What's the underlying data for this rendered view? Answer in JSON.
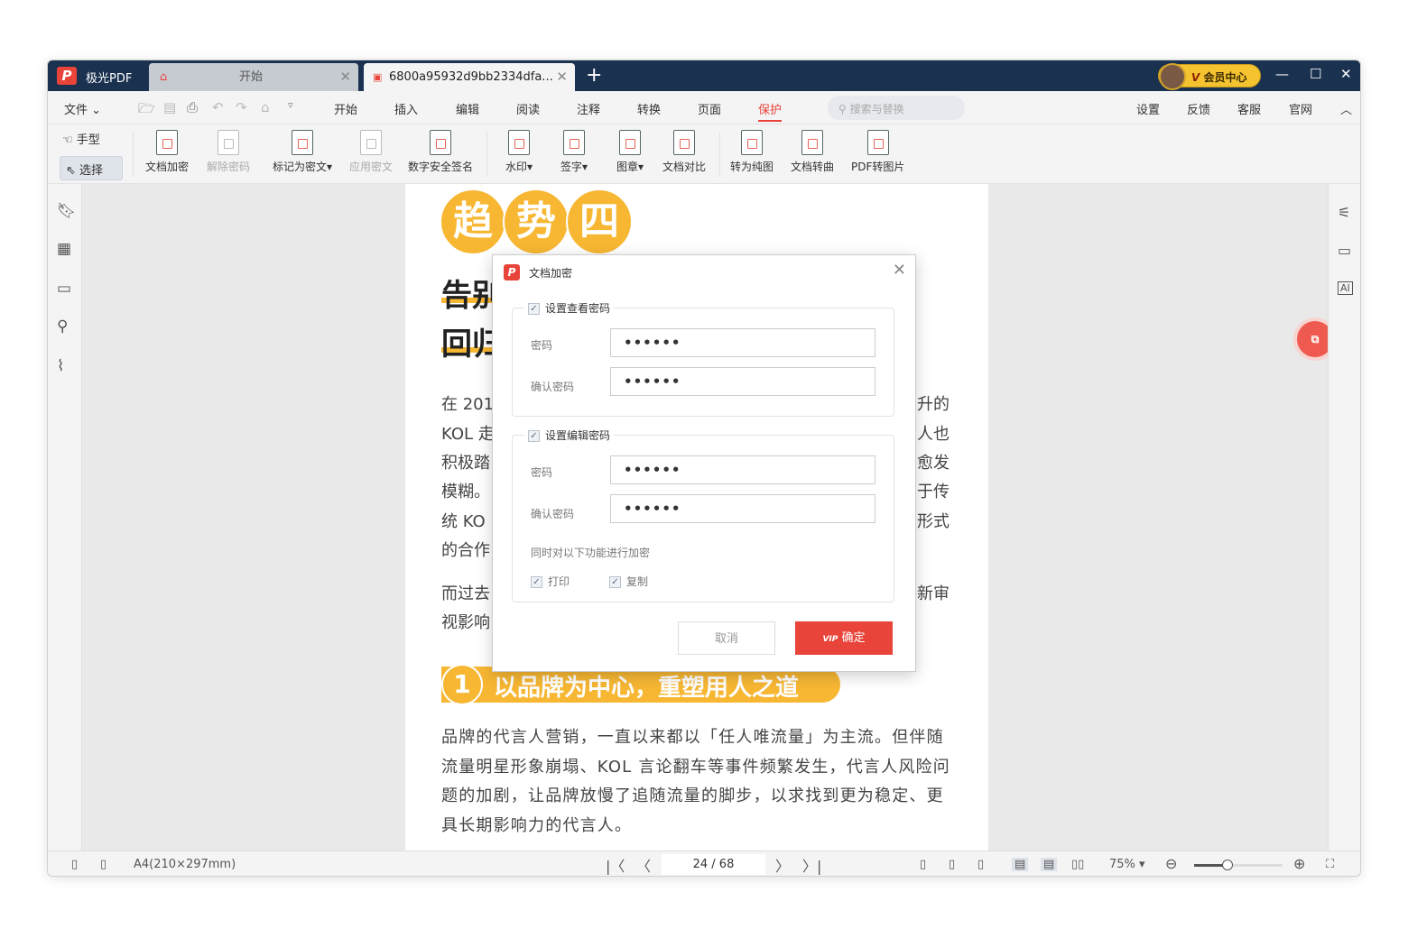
{
  "app": {
    "name": "极光PDF",
    "logo_letter": "P"
  },
  "tabs": [
    {
      "label": "开始"
    },
    {
      "label": "6800a95932d9bb2334dfa..."
    }
  ],
  "vip": {
    "label": "会员中心",
    "badge": "V"
  },
  "menu": {
    "file": "文件",
    "items": [
      "开始",
      "插入",
      "编辑",
      "阅读",
      "注释",
      "转换",
      "页面",
      "保护"
    ],
    "active": "保护",
    "search_placeholder": "搜索与替换",
    "right": [
      "设置",
      "反馈",
      "客服",
      "官网"
    ]
  },
  "ribbon": {
    "hand": "手型",
    "select": "选择",
    "tools": [
      {
        "label": "文档加密",
        "enabled": true
      },
      {
        "label": "解除密码",
        "enabled": false
      },
      {
        "label": "标记为密文▾",
        "enabled": true
      },
      {
        "label": "应用密文",
        "enabled": false
      },
      {
        "label": "数字安全签名",
        "enabled": true
      },
      {
        "label": "水印▾",
        "enabled": true
      },
      {
        "label": "签字▾",
        "enabled": true
      },
      {
        "label": "图章▾",
        "enabled": true
      },
      {
        "label": "文档对比",
        "enabled": true
      },
      {
        "label": "转为纯图",
        "enabled": true
      },
      {
        "label": "文档转曲",
        "enabled": true
      },
      {
        "label": "PDF转图片",
        "enabled": true
      }
    ]
  },
  "document": {
    "title_chars": [
      "趋",
      "势",
      "四"
    ],
    "heading_lines": [
      "告别",
      "回归"
    ],
    "left_fragments": [
      "在 201",
      "KOL 走",
      "积极踏",
      "模糊。",
      "统 KO",
      "的合作",
      "而过去",
      "视影响"
    ],
    "right_fragments": [
      "升的",
      "人也",
      "愈发",
      "于传",
      "形式",
      "新审"
    ],
    "section_number": "1",
    "section_title": "以品牌为中心，重塑用人之道",
    "body": "品牌的代言人营销，一直以来都以「任人唯流量」为主流。但伴随流量明星形象崩塌、KOL 言论翻车等事件频繁发生，代言人风险问题的加剧，让品牌放慢了追随流量的脚步，以求找到更为稳定、更具长期影响力的代言人。"
  },
  "dialog": {
    "title": "文档加密",
    "view_group": {
      "label": "设置查看密码",
      "checked": true,
      "password_label": "密码",
      "password": "••••••",
      "confirm_label": "确认密码",
      "confirm": "••••••"
    },
    "edit_group": {
      "label": "设置编辑密码",
      "checked": true,
      "password_label": "密码",
      "password": "••••••",
      "confirm_label": "确认密码",
      "confirm": "••••••",
      "also_label": "同时对以下功能进行加密",
      "print": "打印",
      "print_checked": true,
      "copy": "复制",
      "copy_checked": true
    },
    "cancel": "取消",
    "ok_badge": "VIP",
    "ok": "确定"
  },
  "status": {
    "page_size": "A4(210×297mm)",
    "page": "24 / 68",
    "zoom": "75%",
    "zoom_slider_percent": 38
  },
  "colors": {
    "titlebar": "#1b3150",
    "accent": "#e8443a",
    "highlight": "#f7b733"
  }
}
